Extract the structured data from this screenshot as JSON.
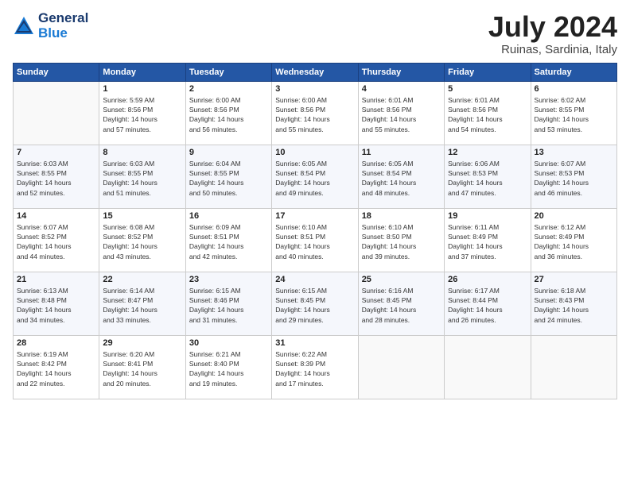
{
  "header": {
    "logo_line1": "General",
    "logo_line2": "Blue",
    "month_year": "July 2024",
    "location": "Ruinas, Sardinia, Italy"
  },
  "weekdays": [
    "Sunday",
    "Monday",
    "Tuesday",
    "Wednesday",
    "Thursday",
    "Friday",
    "Saturday"
  ],
  "weeks": [
    [
      {
        "day": "",
        "info": ""
      },
      {
        "day": "1",
        "info": "Sunrise: 5:59 AM\nSunset: 8:56 PM\nDaylight: 14 hours\nand 57 minutes."
      },
      {
        "day": "2",
        "info": "Sunrise: 6:00 AM\nSunset: 8:56 PM\nDaylight: 14 hours\nand 56 minutes."
      },
      {
        "day": "3",
        "info": "Sunrise: 6:00 AM\nSunset: 8:56 PM\nDaylight: 14 hours\nand 55 minutes."
      },
      {
        "day": "4",
        "info": "Sunrise: 6:01 AM\nSunset: 8:56 PM\nDaylight: 14 hours\nand 55 minutes."
      },
      {
        "day": "5",
        "info": "Sunrise: 6:01 AM\nSunset: 8:56 PM\nDaylight: 14 hours\nand 54 minutes."
      },
      {
        "day": "6",
        "info": "Sunrise: 6:02 AM\nSunset: 8:55 PM\nDaylight: 14 hours\nand 53 minutes."
      }
    ],
    [
      {
        "day": "7",
        "info": "Sunrise: 6:03 AM\nSunset: 8:55 PM\nDaylight: 14 hours\nand 52 minutes."
      },
      {
        "day": "8",
        "info": "Sunrise: 6:03 AM\nSunset: 8:55 PM\nDaylight: 14 hours\nand 51 minutes."
      },
      {
        "day": "9",
        "info": "Sunrise: 6:04 AM\nSunset: 8:55 PM\nDaylight: 14 hours\nand 50 minutes."
      },
      {
        "day": "10",
        "info": "Sunrise: 6:05 AM\nSunset: 8:54 PM\nDaylight: 14 hours\nand 49 minutes."
      },
      {
        "day": "11",
        "info": "Sunrise: 6:05 AM\nSunset: 8:54 PM\nDaylight: 14 hours\nand 48 minutes."
      },
      {
        "day": "12",
        "info": "Sunrise: 6:06 AM\nSunset: 8:53 PM\nDaylight: 14 hours\nand 47 minutes."
      },
      {
        "day": "13",
        "info": "Sunrise: 6:07 AM\nSunset: 8:53 PM\nDaylight: 14 hours\nand 46 minutes."
      }
    ],
    [
      {
        "day": "14",
        "info": "Sunrise: 6:07 AM\nSunset: 8:52 PM\nDaylight: 14 hours\nand 44 minutes."
      },
      {
        "day": "15",
        "info": "Sunrise: 6:08 AM\nSunset: 8:52 PM\nDaylight: 14 hours\nand 43 minutes."
      },
      {
        "day": "16",
        "info": "Sunrise: 6:09 AM\nSunset: 8:51 PM\nDaylight: 14 hours\nand 42 minutes."
      },
      {
        "day": "17",
        "info": "Sunrise: 6:10 AM\nSunset: 8:51 PM\nDaylight: 14 hours\nand 40 minutes."
      },
      {
        "day": "18",
        "info": "Sunrise: 6:10 AM\nSunset: 8:50 PM\nDaylight: 14 hours\nand 39 minutes."
      },
      {
        "day": "19",
        "info": "Sunrise: 6:11 AM\nSunset: 8:49 PM\nDaylight: 14 hours\nand 37 minutes."
      },
      {
        "day": "20",
        "info": "Sunrise: 6:12 AM\nSunset: 8:49 PM\nDaylight: 14 hours\nand 36 minutes."
      }
    ],
    [
      {
        "day": "21",
        "info": "Sunrise: 6:13 AM\nSunset: 8:48 PM\nDaylight: 14 hours\nand 34 minutes."
      },
      {
        "day": "22",
        "info": "Sunrise: 6:14 AM\nSunset: 8:47 PM\nDaylight: 14 hours\nand 33 minutes."
      },
      {
        "day": "23",
        "info": "Sunrise: 6:15 AM\nSunset: 8:46 PM\nDaylight: 14 hours\nand 31 minutes."
      },
      {
        "day": "24",
        "info": "Sunrise: 6:15 AM\nSunset: 8:45 PM\nDaylight: 14 hours\nand 29 minutes."
      },
      {
        "day": "25",
        "info": "Sunrise: 6:16 AM\nSunset: 8:45 PM\nDaylight: 14 hours\nand 28 minutes."
      },
      {
        "day": "26",
        "info": "Sunrise: 6:17 AM\nSunset: 8:44 PM\nDaylight: 14 hours\nand 26 minutes."
      },
      {
        "day": "27",
        "info": "Sunrise: 6:18 AM\nSunset: 8:43 PM\nDaylight: 14 hours\nand 24 minutes."
      }
    ],
    [
      {
        "day": "28",
        "info": "Sunrise: 6:19 AM\nSunset: 8:42 PM\nDaylight: 14 hours\nand 22 minutes."
      },
      {
        "day": "29",
        "info": "Sunrise: 6:20 AM\nSunset: 8:41 PM\nDaylight: 14 hours\nand 20 minutes."
      },
      {
        "day": "30",
        "info": "Sunrise: 6:21 AM\nSunset: 8:40 PM\nDaylight: 14 hours\nand 19 minutes."
      },
      {
        "day": "31",
        "info": "Sunrise: 6:22 AM\nSunset: 8:39 PM\nDaylight: 14 hours\nand 17 minutes."
      },
      {
        "day": "",
        "info": ""
      },
      {
        "day": "",
        "info": ""
      },
      {
        "day": "",
        "info": ""
      }
    ]
  ]
}
